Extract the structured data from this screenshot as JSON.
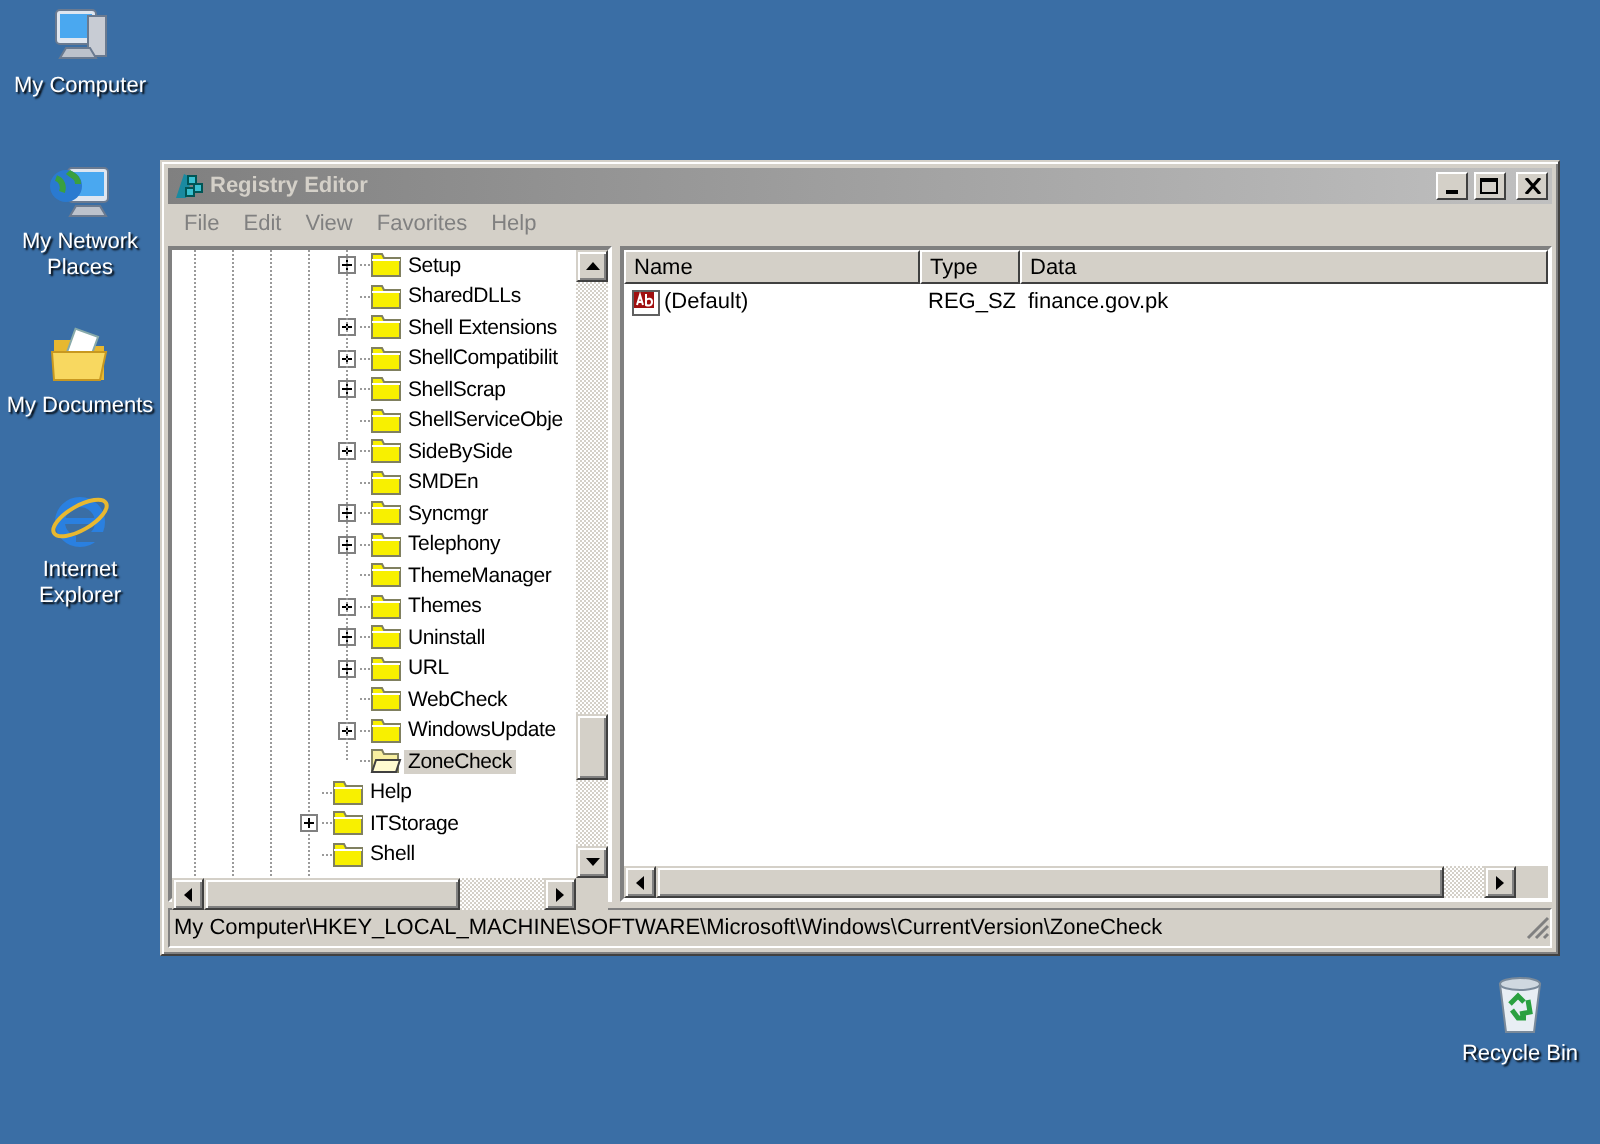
{
  "desktop_icons": [
    {
      "label": "My Computer",
      "kind": "computer"
    },
    {
      "label": "My Network Places",
      "kind": "network"
    },
    {
      "label": "My Documents",
      "kind": "documents"
    },
    {
      "label": "Internet Explorer",
      "kind": "browser"
    },
    {
      "label": "Recycle Bin",
      "kind": "recycle"
    }
  ],
  "window": {
    "title": "Registry Editor",
    "active": false
  },
  "menu": [
    "File",
    "Edit",
    "View",
    "Favorites",
    "Help"
  ],
  "tree": [
    {
      "children": [
        {
          "label": "Setup",
          "expandable": true,
          "selected": false
        },
        {
          "label": "SharedDLLs",
          "expandable": false,
          "selected": false
        },
        {
          "label": "Shell Extensions",
          "expandable": true,
          "selected": false
        },
        {
          "label": "ShellCompatibilit",
          "expandable": true,
          "selected": false
        },
        {
          "label": "ShellScrap",
          "expandable": true,
          "selected": false
        },
        {
          "label": "ShellServiceObje",
          "expandable": false,
          "selected": false
        },
        {
          "label": "SideBySide",
          "expandable": true,
          "selected": false
        },
        {
          "label": "SMDEn",
          "expandable": false,
          "selected": false
        },
        {
          "label": "Syncmgr",
          "expandable": true,
          "selected": false
        },
        {
          "label": "Telephony",
          "expandable": true,
          "selected": false
        },
        {
          "label": "ThemeManager",
          "expandable": false,
          "selected": false
        },
        {
          "label": "Themes",
          "expandable": true,
          "selected": false
        },
        {
          "label": "Uninstall",
          "expandable": true,
          "selected": false
        },
        {
          "label": "URL",
          "expandable": true,
          "selected": false
        },
        {
          "label": "WebCheck",
          "expandable": false,
          "selected": false
        },
        {
          "label": "WindowsUpdate",
          "expandable": true,
          "selected": false
        },
        {
          "label": "ZoneCheck",
          "expandable": false,
          "selected": true
        }
      ]
    },
    {
      "label": "Help",
      "expandable": false,
      "selected": false
    },
    {
      "label": "ITStorage",
      "expandable": true,
      "selected": false
    },
    {
      "label": "Shell",
      "expandable": false,
      "selected": false
    }
  ],
  "values": {
    "columns": [
      "Name",
      "Type",
      "Data"
    ],
    "rows": [
      {
        "name": "(Default)",
        "type": "REG_SZ",
        "data": "finance.gov.pk",
        "kind": "string"
      }
    ]
  },
  "status_bar": "My Computer\\HKEY_LOCAL_MACHINE\\SOFTWARE\\Microsoft\\Windows\\CurrentVersion\\ZoneCheck"
}
